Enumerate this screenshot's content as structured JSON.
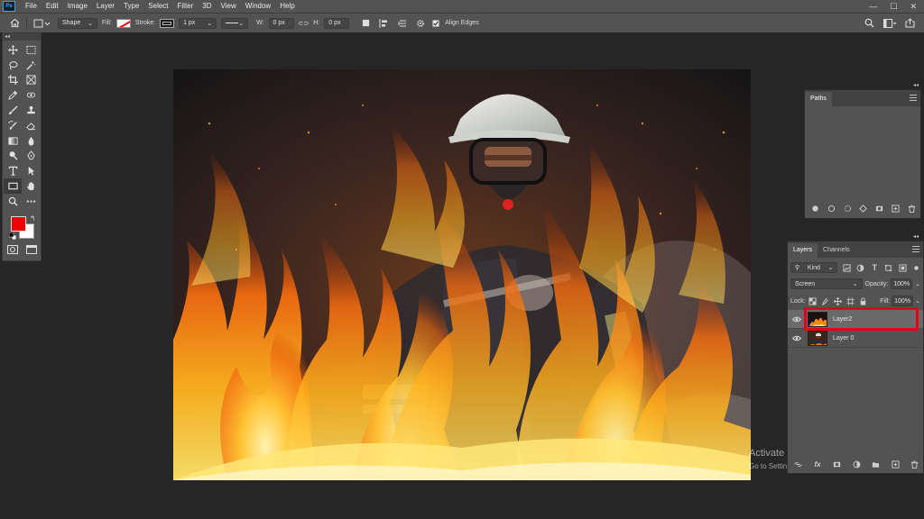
{
  "app": {
    "logo": "Ps"
  },
  "menu": [
    "File",
    "Edit",
    "Image",
    "Layer",
    "Type",
    "Select",
    "Filter",
    "3D",
    "View",
    "Window",
    "Help"
  ],
  "window_controls": {
    "minimize": "—",
    "maximize": "☐",
    "close": "✕"
  },
  "options_bar": {
    "mode": "Shape",
    "fill_label": "Fill:",
    "stroke_label": "Stroke:",
    "stroke_width": "1 px",
    "w_label": "W:",
    "w_value": "0 px",
    "h_label": "H:",
    "h_value": "0 px",
    "align_edges": "Align Edges"
  },
  "toolbox": {
    "collapse": "◂◂",
    "foreground_color": "#ee0000",
    "background_color": "#ffffff"
  },
  "paths_panel": {
    "tab": "Paths",
    "collapse": "◂◂"
  },
  "layers_panel": {
    "collapse": "◂◂",
    "tabs": [
      "Layers",
      "Channels"
    ],
    "filter_kind": "Kind",
    "blend_mode": "Screen",
    "opacity_label": "Opacity:",
    "opacity_value": "100%",
    "lock_label": "Lock:",
    "fill_label": "Fill:",
    "fill_value": "100%",
    "layers": [
      {
        "name": "Layer2",
        "selected": true,
        "visible": true
      },
      {
        "name": "Layer 0",
        "selected": false,
        "visible": true
      }
    ],
    "highlight_color": "#e3001b"
  },
  "watermark": {
    "title": "Activate Windows",
    "subtitle": "Go to Settings to activate Windows."
  }
}
